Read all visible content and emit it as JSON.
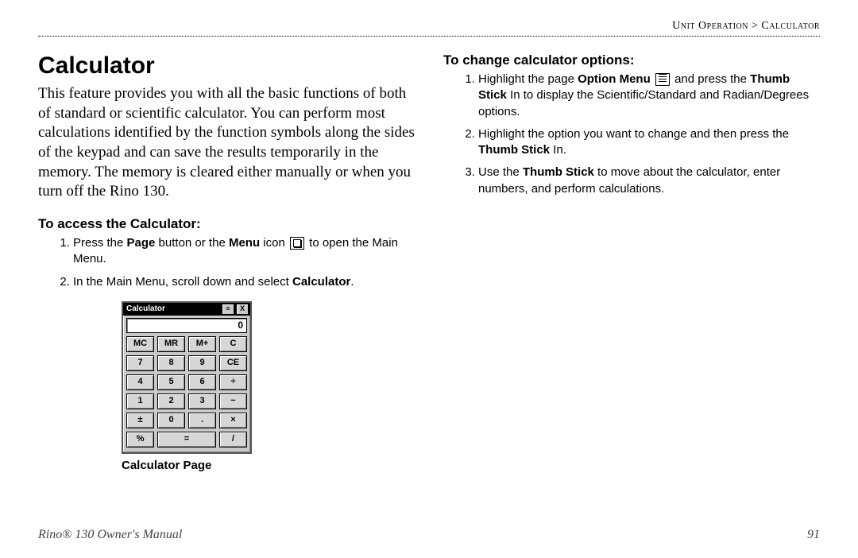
{
  "header": {
    "section": "Unit Operation",
    "sep": ">",
    "page": "Calculator"
  },
  "left": {
    "title": "Calculator",
    "intro": "This feature provides you with all the basic functions of both of standard or scientific calculator. You can perform most calculations identified by the function symbols along the sides of the keypad and can save the results temporarily in the memory. The memory is cleared either manually or when you turn off the Rino 130.",
    "sub": "To access the Calculator:",
    "s1a": "Press the ",
    "s1b": "Page",
    "s1c": " button or the ",
    "s1d": "Menu",
    "s1e": " icon ",
    "s1f": " to open the Main Menu.",
    "s2a": "In the Main Menu, scroll down and select ",
    "s2b": "Calculator",
    "s2c": ".",
    "calc_caption": "Calculator Page"
  },
  "right": {
    "sub": "To change calculator options:",
    "s1a": "Highlight the page ",
    "s1b": "Option Menu",
    "s1c": " ",
    "s1d": " and press the ",
    "s1e": "Thumb Stick",
    "s1f": " In to display the Scientific/Standard and Radian/Degrees options.",
    "s2a": "Highlight the option you want to change and then press the ",
    "s2b": "Thumb Stick",
    "s2c": " In.",
    "s3a": "Use the ",
    "s3b": "Thumb Stick",
    "s3c": " to move about the calculator, enter numbers, and perform calculations."
  },
  "calc": {
    "title": "Calculator",
    "tb_menu": "≡",
    "tb_close": "X",
    "display": "0",
    "rows": [
      [
        "MC",
        "MR",
        "M+",
        "C"
      ],
      [
        "7",
        "8",
        "9",
        "CE"
      ],
      [
        "4",
        "5",
        "6",
        "÷"
      ],
      [
        "1",
        "2",
        "3",
        "−"
      ],
      [
        "±",
        "0",
        ".",
        "×"
      ],
      [
        "%",
        "=",
        "/"
      ]
    ],
    "wide_row_index": 5,
    "wide_key_index": 1
  },
  "footer": {
    "manual": "Rino® 130 Owner's Manual",
    "page_no": "91"
  }
}
